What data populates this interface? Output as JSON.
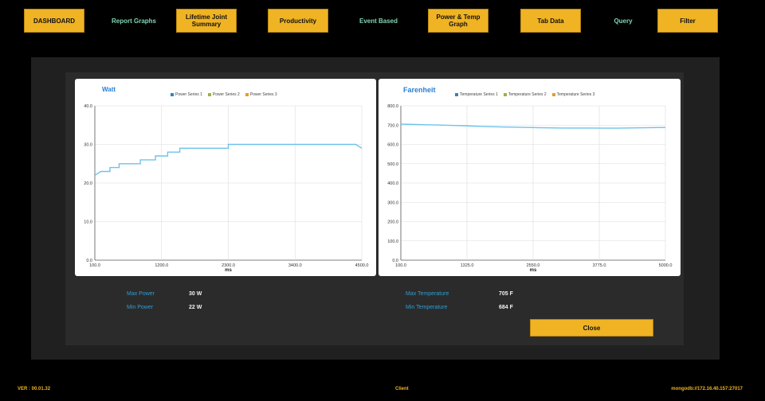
{
  "nav": {
    "dashboard": "DASHBOARD",
    "report_graphs": "Report Graphs",
    "lifetime_joint_summary": "Lifetime Joint Summary",
    "productivity": "Productivity",
    "event_based": "Event Based",
    "power_temp_graph": "Power & Temp Graph",
    "tab_data": "Tab Data",
    "query": "Query",
    "filter": "Filter"
  },
  "colors": {
    "accent": "#f0b323",
    "link": "#7fd8b4",
    "series": "#6ec3ea",
    "stat_label": "#2a9fd6"
  },
  "chart_data": [
    {
      "type": "line",
      "title": "Watt",
      "xlabel": "ms",
      "ylabel": "",
      "xlim": [
        100,
        4500
      ],
      "ylim": [
        0,
        40
      ],
      "x_ticks": [
        "100.0",
        "1200.0",
        "2300.0",
        "3400.0",
        "4500.0"
      ],
      "y_ticks": [
        "0.0",
        "10.0",
        "20.0",
        "30.0",
        "40.0"
      ],
      "legend": [
        "Power Series 1",
        "Power Series 2",
        "Power Series 3"
      ],
      "legend_colors": [
        "#2e86c1",
        "#a0b040",
        "#e69a2e"
      ],
      "legend_position": "top-center",
      "grid": true,
      "series": [
        {
          "name": "Power Series 1",
          "x": [
            100,
            200,
            200,
            350,
            350,
            500,
            500,
            650,
            650,
            850,
            850,
            1100,
            1100,
            1300,
            1300,
            1500,
            1500,
            2300,
            2300,
            4400,
            4500
          ],
          "y": [
            22,
            23,
            23,
            23,
            24,
            24,
            25,
            25,
            25,
            25,
            26,
            26,
            27,
            27,
            28,
            28,
            29,
            29,
            30,
            30,
            29
          ]
        }
      ]
    },
    {
      "type": "line",
      "title": "Farenheit",
      "xlabel": "ms",
      "ylabel": "",
      "xlim": [
        100,
        5000
      ],
      "ylim": [
        0,
        800
      ],
      "x_ticks": [
        "100.0",
        "1325.0",
        "2550.0",
        "3775.0",
        "5000.0"
      ],
      "y_ticks": [
        "0.0",
        "100.0",
        "200.0",
        "300.0",
        "400.0",
        "500.0",
        "600.0",
        "700.0",
        "800.0"
      ],
      "legend": [
        "Temperature Series 1",
        "Temperature Series 2",
        "Temperature Series 3"
      ],
      "legend_colors": [
        "#2e86c1",
        "#a0b040",
        "#e69a2e"
      ],
      "legend_position": "top-center",
      "grid": true,
      "series": [
        {
          "name": "Temperature Series 1",
          "x": [
            100,
            600,
            1100,
            1600,
            2100,
            2600,
            3100,
            3600,
            4100,
            4600,
            5000
          ],
          "y": [
            705,
            702,
            698,
            693,
            690,
            687,
            685,
            685,
            684,
            686,
            688
          ]
        }
      ]
    }
  ],
  "stats": {
    "max_power_label": "Max Power",
    "max_power_value": "30 W",
    "min_power_label": "Min Power",
    "min_power_value": "22 W",
    "max_temp_label": "Max Temperature",
    "max_temp_value": "705 F",
    "min_temp_label": "Min Temperature",
    "min_temp_value": "684 F"
  },
  "close_label": "Close",
  "footer": {
    "version": "VER : 00.01.32",
    "client": "Client",
    "connection": "mongodb://172.16.40.157:27017"
  }
}
